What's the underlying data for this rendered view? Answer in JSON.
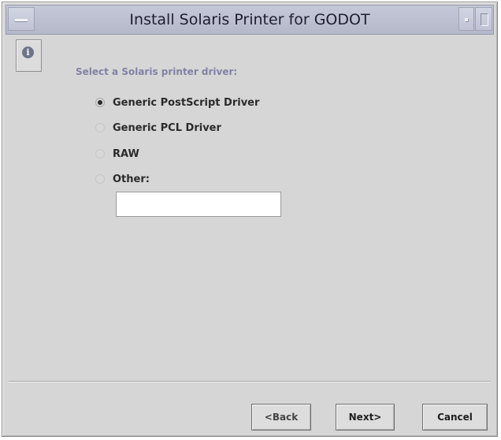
{
  "window": {
    "title": "Install Solaris Printer for GODOT"
  },
  "titlebar_icons": {
    "menu": "window-menu-icon",
    "minimize": "minimize-icon",
    "maximize": "maximize-icon"
  },
  "info_icon": {
    "name": "info-icon",
    "glyph": "i"
  },
  "form": {
    "prompt": "Select a Solaris printer driver:",
    "options": [
      {
        "label": "Generic PostScript Driver",
        "selected": true
      },
      {
        "label": "Generic PCL Driver",
        "selected": false
      },
      {
        "label": "RAW",
        "selected": false
      },
      {
        "label": "Other:",
        "selected": false
      }
    ],
    "other_value": "",
    "selected_index": 0
  },
  "buttons": {
    "back": "<Back",
    "next": "Next>",
    "cancel": "Cancel"
  },
  "colors": {
    "window_bg": "#d6d6d6",
    "titlebar_bg": "#b8bccc",
    "prompt_text": "#8282a6"
  }
}
